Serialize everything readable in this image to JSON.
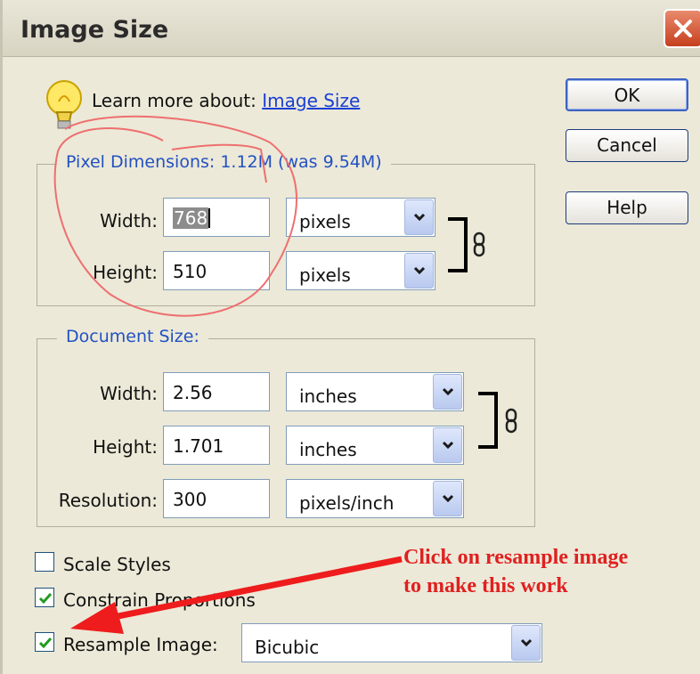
{
  "window": {
    "title": "Image Size"
  },
  "icons": {
    "close": "close-icon",
    "help_hint": "lightbulb-icon",
    "link_proportions": "chain-link-icon"
  },
  "learn_more": {
    "prefix": "Learn more about:",
    "link": "Image Size"
  },
  "buttons": {
    "ok": "OK",
    "cancel": "Cancel",
    "help": "Help"
  },
  "pixel_dimensions": {
    "legend": "Pixel Dimensions:  1.12M (was 9.54M)",
    "width": {
      "label": "Width:",
      "value": "768",
      "unit": "pixels"
    },
    "height": {
      "label": "Height:",
      "value": "510",
      "unit": "pixels"
    }
  },
  "document_size": {
    "legend": "Document Size:",
    "width": {
      "label": "Width:",
      "value": "2.56",
      "unit": "inches"
    },
    "height": {
      "label": "Height:",
      "value": "1.701",
      "unit": "inches"
    },
    "resolution": {
      "label": "Resolution:",
      "value": "300",
      "unit": "pixels/inch"
    }
  },
  "options": {
    "scale_styles": {
      "label": "Scale Styles",
      "checked": false
    },
    "constrain_proportions": {
      "label": "Constrain Proportions",
      "checked": true
    },
    "resample_image": {
      "label": "Resample Image:",
      "checked": true,
      "method": "Bicubic"
    }
  },
  "annotation": {
    "line1": "Click on resample image",
    "line2": "to make this work",
    "color": "#e02020"
  },
  "colors": {
    "legend": "#2251c2",
    "link": "#1a3fd4",
    "title_close": "#c5401e"
  }
}
